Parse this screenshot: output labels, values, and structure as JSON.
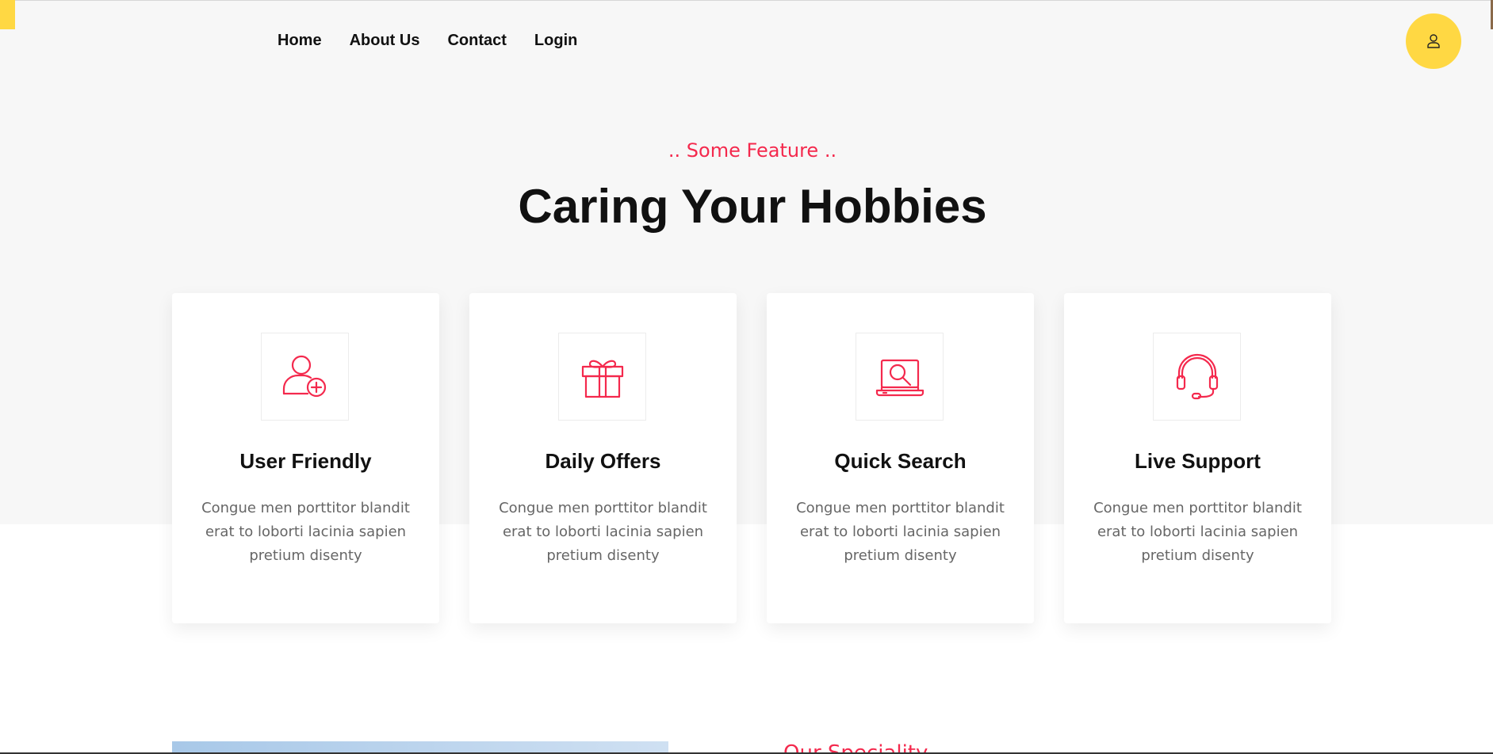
{
  "nav": {
    "items": [
      {
        "label": "Home"
      },
      {
        "label": "About Us"
      },
      {
        "label": "Contact"
      },
      {
        "label": "Login"
      }
    ]
  },
  "header": {
    "user_icon": "user-icon"
  },
  "hero": {
    "eyebrow": ".. Some Feature ..",
    "title": "Caring Your Hobbies"
  },
  "features": [
    {
      "icon": "user-add-icon",
      "title": "User Friendly",
      "desc": "Congue men porttitor blandit erat to loborti lacinia sapien pretium disenty"
    },
    {
      "icon": "gift-icon",
      "title": "Daily Offers",
      "desc": "Congue men porttitor blandit erat to loborti lacinia sapien pretium disenty"
    },
    {
      "icon": "laptop-search-icon",
      "title": "Quick Search",
      "desc": "Congue men porttitor blandit erat to loborti lacinia sapien pretium disenty"
    },
    {
      "icon": "headset-icon",
      "title": "Live Support",
      "desc": "Congue men porttitor blandit erat to loborti lacinia sapien pretium disenty"
    }
  ],
  "next_section": {
    "eyebrow": "Our Speciality"
  },
  "colors": {
    "accent": "#f4294d",
    "brand_yellow": "#ffd843",
    "band_bg": "#f7f7f7"
  }
}
